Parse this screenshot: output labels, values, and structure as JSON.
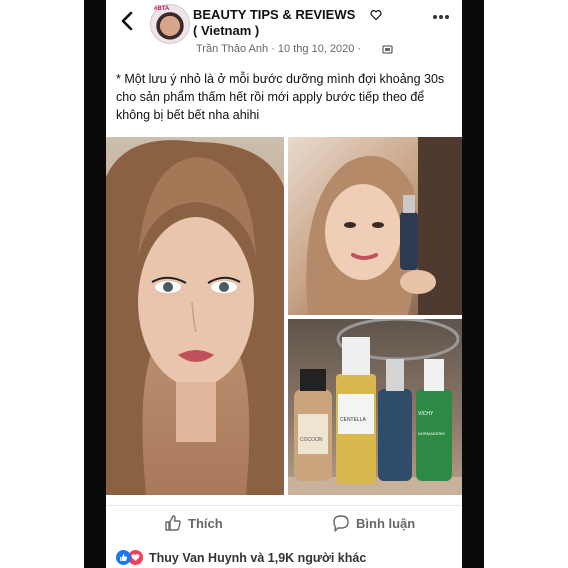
{
  "header": {
    "group_name_line1": "BEAUTY TIPS & REVIEWS",
    "group_name_line2": "( Vietnam )",
    "author_date": "Trần Thảo Anh · 10 thg 10, 2020 ·",
    "avatar_text": "#BTA"
  },
  "post": {
    "text": "* Một lưu ý nhỏ là ở mỗi bước dưỡng mình đợi khoảng 30s cho sản phẩm thấm hết rồi mới apply bước tiếp theo để không bị bết bết nha ahihi"
  },
  "products": {
    "label_cocoon": "COCOON",
    "label_centella": "CENTELLA",
    "label_vichy": "VICHY",
    "label_normaderm": "NORMADERM"
  },
  "actions": {
    "like_label": "Thích",
    "comment_label": "Bình luận"
  },
  "reactions": {
    "text": "Thuy Van Huynh và 1,9K người khác"
  },
  "colors": {
    "like_blue": "#1877f2",
    "love_red": "#f33e58",
    "meta_gray": "#65676b"
  }
}
